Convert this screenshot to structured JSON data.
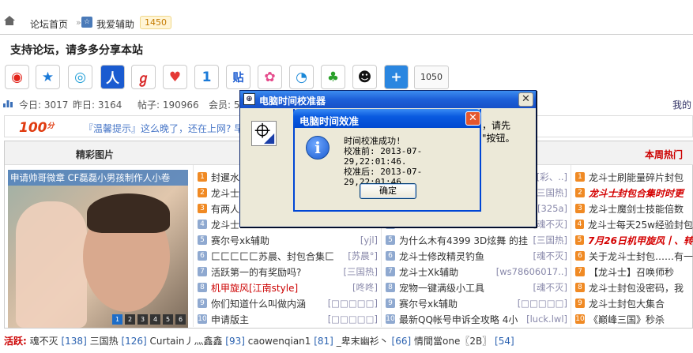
{
  "breadcrumb": {
    "home_label": "论坛首页",
    "sep": "»",
    "forum": "我爱辅助",
    "forum_count": "1450"
  },
  "slogan": "支持论坛，请多多分享本站",
  "share": {
    "count": "1050"
  },
  "stats": {
    "today": "今日: 3017",
    "yesterday": "昨日: 3164",
    "posts": "帖子: 190966",
    "members": "会员: 5",
    "mine": "我的"
  },
  "tips": {
    "logo": "100",
    "logo_sup": "分",
    "text": "『温馨提示』这么晚了，还在上网? 早"
  },
  "sections": {
    "pics": "精彩图片",
    "hot": "本周热门"
  },
  "slider": {
    "caption": "申请帅哥微章    CF磊磊小男孩制作人小卷",
    "pages": [
      "1",
      "2",
      "3",
      "4",
      "5",
      "6"
    ]
  },
  "list1": [
    {
      "n": "1",
      "t": "封暹水",
      "m": ""
    },
    {
      "n": "2",
      "t": "龙斗士",
      "m": ""
    },
    {
      "n": "3",
      "t": "有两人",
      "m": ""
    },
    {
      "n": "4",
      "t": "龙斗士",
      "m": ""
    },
    {
      "n": "5",
      "t": "赛尔号xk辅助",
      "m": "[yjl]"
    },
    {
      "n": "6",
      "t": "匚匚匚匚匚苏晨、封包合集匚",
      "m": "[苏晨°]"
    },
    {
      "n": "7",
      "t": "活跃第一的有奖励吗?",
      "m": "[三国热]"
    },
    {
      "n": "8",
      "t": "机甲旋风[江南style]",
      "m": "[咚咚]"
    },
    {
      "n": "9",
      "t": "你们知道什么叫做内涵",
      "m": "[□□□□□]"
    },
    {
      "n": "10",
      "t": "申请版主",
      "m": "[□□□□□]"
    }
  ],
  "list2": [
    {
      "n": "1",
      "t": "",
      "m": "[彩、..]"
    },
    {
      "n": "2",
      "t": "",
      "m": "[三国热]"
    },
    {
      "n": "3",
      "t": "",
      "m": "[325a]"
    },
    {
      "n": "4",
      "t": "",
      "m": "[魂不灭]"
    },
    {
      "n": "5",
      "t": "为什么木有4399 3D炫舞 的挂",
      "m": "[三国热]"
    },
    {
      "n": "6",
      "t": "龙斗士修改精灵钓鱼",
      "m": "[魂不灭]"
    },
    {
      "n": "7",
      "t": "龙斗士Xk辅助",
      "m": "[ws78606017..]"
    },
    {
      "n": "8",
      "t": "宠物一键满级小工具",
      "m": "[魂不灭]"
    },
    {
      "n": "9",
      "t": "赛尔号xk辅助",
      "m": "[□□□□□]"
    },
    {
      "n": "10",
      "t": "最新QQ帐号申诉全攻略 4小",
      "m": "[luck.lwl]"
    }
  ],
  "list3": [
    {
      "n": "1",
      "t": "龙斗士刷能量碎片封包",
      "red": false
    },
    {
      "n": "2",
      "t": "龙斗士封包合集时时更",
      "red": true
    },
    {
      "n": "3",
      "t": "龙斗士魔剑士技能倍数",
      "red": false
    },
    {
      "n": "4",
      "t": "龙斗士每天25w经验封包",
      "red": false
    },
    {
      "n": "5",
      "t": "7月26日机甲旋风丨、转",
      "red": true
    },
    {
      "n": "6",
      "t": "关于龙斗士封包……有一",
      "red": false
    },
    {
      "n": "7",
      "t": "【龙斗士】召唤师秒",
      "red": false
    },
    {
      "n": "8",
      "t": "龙斗士封包没密码，我",
      "red": false
    },
    {
      "n": "9",
      "t": "龙斗士封包大集合",
      "red": false
    },
    {
      "n": "10",
      "t": "《巅峰三国》秒杀",
      "red": false
    }
  ],
  "active": {
    "label": "活跃:",
    "items": [
      {
        "name": "魂不灭",
        "n": "[138]"
      },
      {
        "name": "三国热",
        "n": "[126]"
      },
      {
        "name": "Curtain丿灬鑫鑫",
        "n": "[93]"
      },
      {
        "name": "caowenqian1",
        "n": "[81]"
      },
      {
        "name": "_卑末幽衫丶",
        "n": "[66]"
      },
      {
        "name": "情間當one〖2B〗",
        "n": "[54]"
      }
    ]
  },
  "win1": {
    "title": "电脑时间校准器",
    "msg1": "，请先",
    "msg2": "\"按钮。"
  },
  "win2": {
    "title": "电脑时间效准",
    "line1": "时间校准成功!",
    "line2": "校准前: 2013-07-29,22:01:46.",
    "line3": "校准后: 2013-07-29,22:01:46.",
    "ok": "确定"
  }
}
